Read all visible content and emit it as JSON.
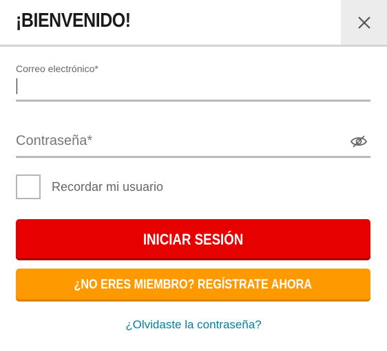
{
  "header": {
    "title": "¡BIENVENIDO!",
    "close_icon": "close-icon"
  },
  "email": {
    "label": "Correo electrónico*",
    "value": "",
    "placeholder": ""
  },
  "password": {
    "value": "",
    "placeholder": "Contraseña*",
    "toggle_icon": "eye-slash-icon"
  },
  "remember": {
    "label": "Recordar mi usuario",
    "checked": false
  },
  "buttons": {
    "login_label": "INICIAR SESIÓN",
    "register_label": "¿NO ERES MIEMBRO? REGÍSTRATE AHORA"
  },
  "forgot": {
    "label": "¿Olvidaste la contraseña?"
  },
  "colors": {
    "login": "#e60000",
    "register": "#ff9900",
    "link": "#00829b"
  }
}
